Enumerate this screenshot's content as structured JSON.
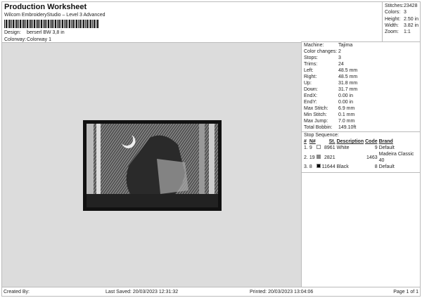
{
  "header": {
    "title": "Production Worksheet",
    "software": "Wilcom EmbroideryStudio – Level 3 Advanced",
    "design_label": "Design:",
    "design": "berserl BW 3,8 in",
    "colorway_label": "Colorway:",
    "colorway": "Colorway 1"
  },
  "stats": [
    {
      "k": "Stitches:",
      "v": "23428"
    },
    {
      "k": "Colors:",
      "v": "3"
    },
    {
      "k": "Height:",
      "v": "2.50 in"
    },
    {
      "k": "Width:",
      "v": "3.82 in"
    },
    {
      "k": "Zoom:",
      "v": "1:1"
    }
  ],
  "machine": [
    {
      "k": "Machine:",
      "v": "Tajima"
    },
    {
      "k": "Color changes:",
      "v": "2"
    },
    {
      "k": "Stops:",
      "v": "3"
    },
    {
      "k": "Trims:",
      "v": "24"
    },
    {
      "k": "Left:",
      "v": "48.5 mm"
    },
    {
      "k": "Right:",
      "v": "48.5 mm"
    },
    {
      "k": "Up:",
      "v": "31.8 mm"
    },
    {
      "k": "Down:",
      "v": "31.7 mm"
    },
    {
      "k": "EndX:",
      "v": "0.00 in"
    },
    {
      "k": "EndY:",
      "v": "0.00 in"
    },
    {
      "k": "Max Stitch:",
      "v": "6.9 mm"
    },
    {
      "k": "Min Stitch:",
      "v": "0.1 mm"
    },
    {
      "k": "Max Jump:",
      "v": "7.0 mm"
    },
    {
      "k": "Total Bobbin:",
      "v": "149.10ft"
    }
  ],
  "stop_sequence": {
    "label": "Stop Sequence:",
    "headers": [
      "#",
      "N#",
      "St.",
      "Description",
      "Code",
      "Brand"
    ],
    "rows": [
      {
        "n": "1.",
        "needle": "9",
        "color": "#ffffff",
        "st": "8961",
        "desc": "White",
        "code": "9",
        "brand": "Default"
      },
      {
        "n": "2.",
        "needle": "19",
        "color": "#8a8a8a",
        "st": "2821",
        "desc": "",
        "code": "1463",
        "brand": "Madeira Classic 40"
      },
      {
        "n": "3.",
        "needle": "8",
        "color": "#000000",
        "st": "11644",
        "desc": "Black",
        "code": "8",
        "brand": "Default"
      }
    ]
  },
  "footer": {
    "created": "Created By:",
    "saved": "Last Saved: 20/03/2023 12:31:32",
    "printed": "Printed: 20/03/2023 13:04:06",
    "page": "Page 1 of 1"
  }
}
